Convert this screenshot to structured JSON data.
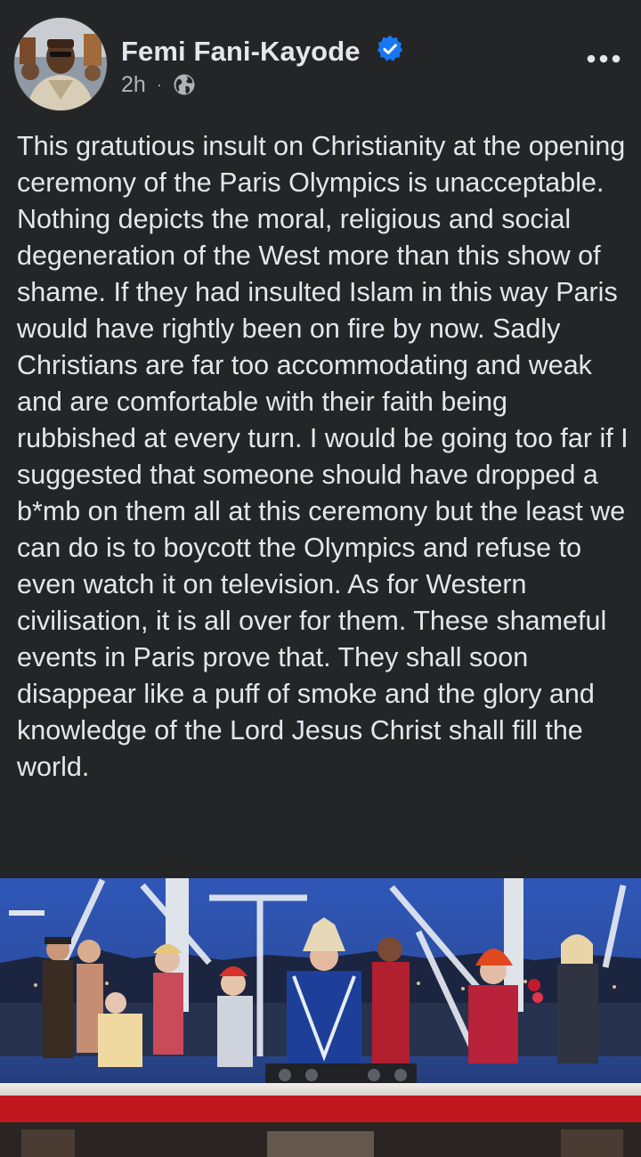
{
  "post": {
    "author": {
      "name": "Femi Fani-Kayode",
      "verified": true,
      "avatar_icon": "profile-photo"
    },
    "meta": {
      "time": "2h",
      "separator": "·",
      "audience_icon": "globe-icon"
    },
    "more_icon": "more-horizontal-icon",
    "text": "This gratutious insult on Christianity at the opening ceremony of the Paris Olympics is unacceptable. Nothing depicts the moral, religious and social degeneration of the West more than this show of shame. If they had insulted Islam in this way Paris would have rightly been on fire by now. Sadly Christians are far too accommodating and weak and are comfortable with their faith being rubbished at every turn. I would be going too far if I suggested that someone should have dropped a b*mb on them all at this ceremony but the least we can do is to boycott the Olympics and refuse to even watch it on television. As for Western civilisation, it is all over for them. These shameful events in Paris prove that. They shall soon disappear like a puff of smoke and the glory and knowledge of the Lord Jesus Christ shall fill the world.",
    "image": {
      "icon": "photo"
    }
  },
  "colors": {
    "background": "#242526",
    "text_primary": "#e4e6eb",
    "text_secondary": "#b0b3b8",
    "verified_blue": "#1877f2"
  }
}
